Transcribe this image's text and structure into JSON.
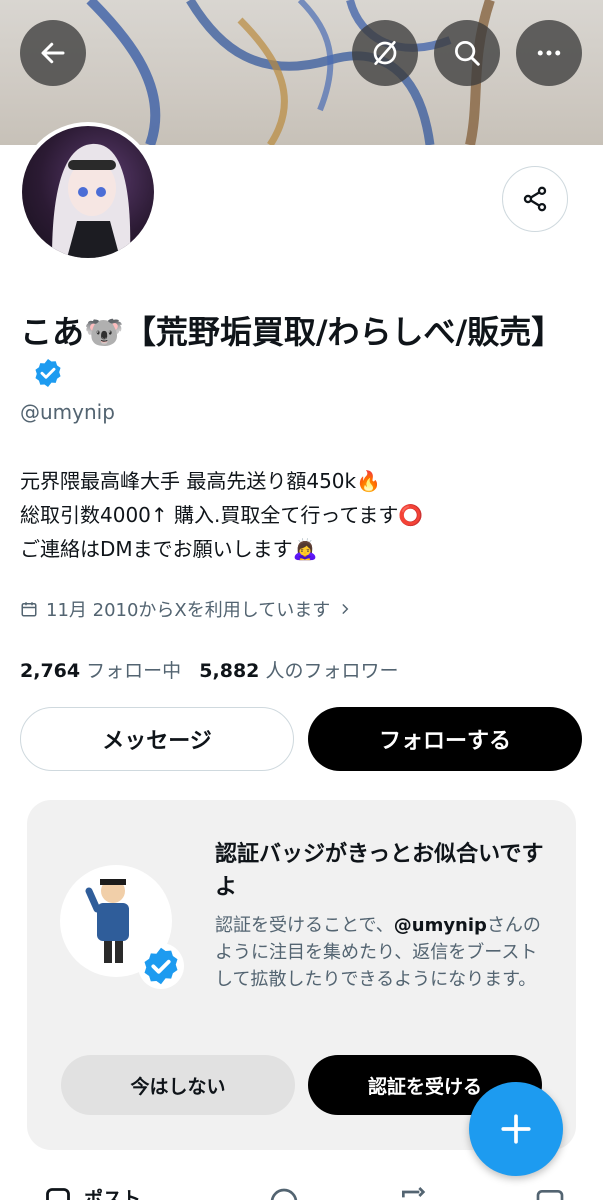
{
  "header": {
    "back_icon": "arrow-left-icon",
    "actions": [
      "hide-banner-icon",
      "search-icon",
      "more-icon"
    ]
  },
  "profile": {
    "name": "こあ🐨【荒野垢買取/わらしべ/販売】",
    "handle": "@umynip",
    "bio_lines": [
      "元界隈最高峰大手 最高先送り額450k🔥",
      "総取引数4000↑ 購入.買取全て行ってます⭕️",
      "ご連絡はDMまでお願いします🙇‍♀️"
    ],
    "joined": "11月 2010からXを利用しています",
    "following_count": "2,764",
    "following_label": "フォロー中",
    "followers_count": "5,882",
    "followers_label": "人のフォロワー"
  },
  "buttons": {
    "message": "メッセージ",
    "follow": "フォローする"
  },
  "verify_card": {
    "title": "認証バッジがきっとお似合いですよ",
    "body_prefix": "認証を受けることで、",
    "body_handle": "@umynip",
    "body_suffix": "さんのように注目を集めたり、返信をブーストして拡散したりできるようになります。",
    "not_now": "今はしない",
    "verify": "認証を受ける"
  },
  "tabs": {
    "first": "ポスト"
  },
  "colors": {
    "accent": "#1d9bf0",
    "text": "#0f1419",
    "secondary": "#536471"
  }
}
